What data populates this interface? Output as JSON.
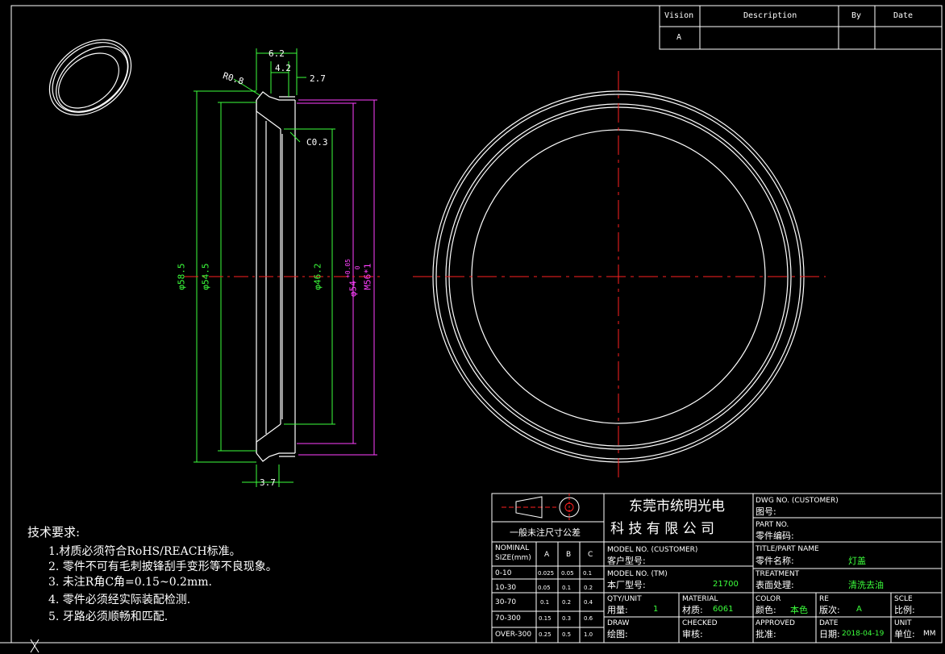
{
  "colors": {
    "background": "#000000",
    "outline": "#ffffff",
    "center_line": "#ff2020",
    "dim_green": "#3cff3c",
    "dim_magenta": "#ff40ff",
    "value_green": "#3cff3c"
  },
  "revision_table": {
    "headers": [
      "Vision",
      "Description",
      "By",
      "Date"
    ],
    "row": {
      "vision": "A",
      "description": "",
      "by": "",
      "date": ""
    }
  },
  "dimensions": {
    "w62": "6.2",
    "w42": "4.2",
    "w27": "2.7",
    "r08": "R0.8",
    "c03": "C0.3",
    "d585": "φ58.5",
    "d545": "φ54.5",
    "d462": "φ46.2",
    "d54": "φ54",
    "d54_tol_upper": "+0.05",
    "d54_tol_lower": "0",
    "m56": "M56*1",
    "w37": "3.7"
  },
  "notes": {
    "title": "技术要求:",
    "items": [
      "1.材质必须符合RoHS/REACH标准。",
      "2. 零件不可有毛刺披锋刮手变形等不良现象。",
      "3. 未注R角C角=0.15~0.2mm.",
      "4. 零件必须经实际装配检测.",
      "5. 牙路必须顺畅和匹配."
    ]
  },
  "title_block": {
    "company_line1": "东莞市统明光电",
    "company_line2": "科 技 有 限 公 司",
    "tolerance_title": "一般未注尺寸公差",
    "tol_headers": [
      "NOMINAL",
      "SIZE(mm)",
      "A",
      "B",
      "C"
    ],
    "tol_rows": [
      [
        "0-10",
        "0.025",
        "0.05",
        "0.1"
      ],
      [
        "10-30",
        "0.05",
        "0.1",
        "0.2"
      ],
      [
        "30-70",
        "0.1",
        "0.2",
        "0.4"
      ],
      [
        "70-300",
        "0.15",
        "0.3",
        "0.6"
      ],
      [
        "OVER-300",
        "0.25",
        "0.5",
        "1.0"
      ]
    ],
    "dwg_no_label": "DWG NO. (CUSTOMER)",
    "dwg_no_cn": "图号:",
    "part_no_label": "PART NO.",
    "part_no_cn": "零件编码:",
    "model_customer_label": "MODEL NO. (CUSTOMER)",
    "model_customer_cn": "客户型号:",
    "title_label": "TITLE/PART NAME",
    "title_cn": "零件名称:",
    "title_value": "灯盖",
    "model_tm_label": "MODEL NO. (TM)",
    "model_tm_cn": "本厂型号:",
    "model_tm_value": "21700",
    "treatment_label": "TREATMENT",
    "treatment_cn": "表面处理:",
    "treatment_value": "清洗去油",
    "qty_label": "QTY/UNIT",
    "qty_cn": "用量:",
    "qty_value": "1",
    "material_label": "MATERIAL",
    "material_cn": "材质:",
    "material_value": "6061",
    "color_label": "COLOR",
    "color_cn": "颜色:",
    "color_value": "本色",
    "re_label": "RE",
    "re_cn": "版次:",
    "re_value": "A",
    "scale_label": "SCLE",
    "scale_cn": "比例:",
    "draw_label": "DRAW",
    "draw_cn": "绘图:",
    "checked_label": "CHECKED",
    "checked_cn": "审核:",
    "approved_label": "APPROVED",
    "approved_cn": "批准:",
    "date_label": "DATE",
    "date_cn": "日期:",
    "date_value": "2018-04-19",
    "unit_label": "UNIT",
    "unit_cn": "单位:",
    "unit_value": "MM"
  }
}
